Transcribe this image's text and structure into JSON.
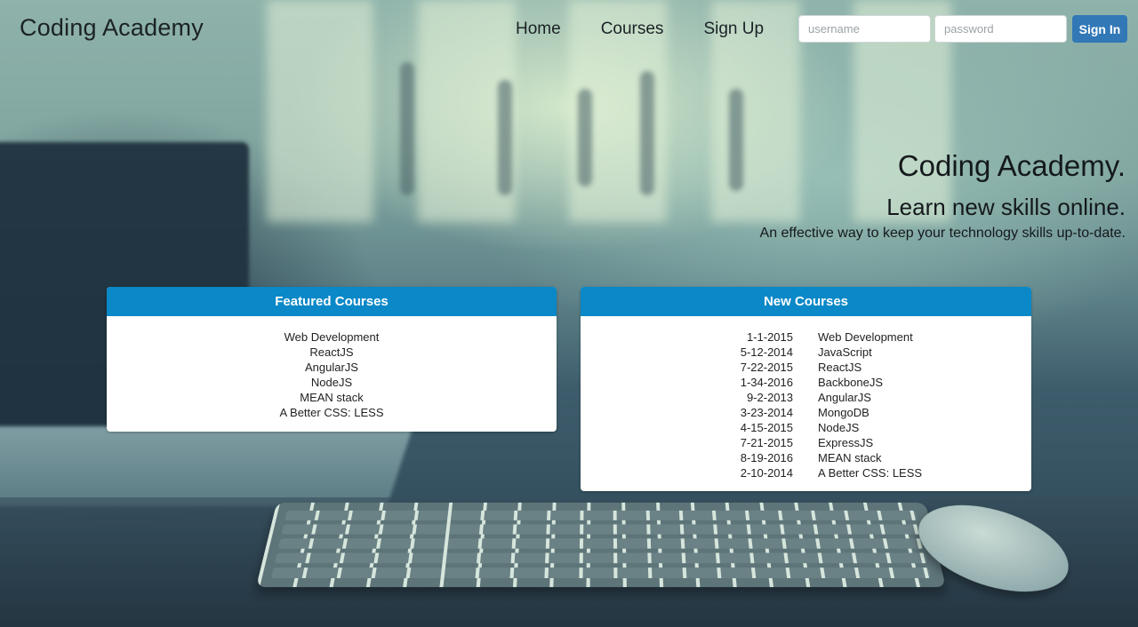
{
  "navbar": {
    "brand": "Coding Academy",
    "links": [
      "Home",
      "Courses",
      "Sign Up"
    ],
    "username_placeholder": "username",
    "password_placeholder": "password",
    "signin_label": "Sign In",
    "signin_color": "#3278b7"
  },
  "hero": {
    "title": "Coding Academy.",
    "subtitle": "Learn new skills online.",
    "description": "An effective way to keep your technology skills up-to-date."
  },
  "featured": {
    "title": "Featured Courses",
    "items": [
      "Web Development",
      "ReactJS",
      "AngularJS",
      "NodeJS",
      "MEAN stack",
      "A Better CSS: LESS"
    ]
  },
  "new_courses": {
    "title": "New Courses",
    "rows": [
      {
        "date": "1-1-2015",
        "name": "Web Development"
      },
      {
        "date": "5-12-2014",
        "name": "JavaScript"
      },
      {
        "date": "7-22-2015",
        "name": "ReactJS"
      },
      {
        "date": "1-34-2016",
        "name": "BackboneJS"
      },
      {
        "date": "9-2-2013",
        "name": "AngularJS"
      },
      {
        "date": "3-23-2014",
        "name": "MongoDB"
      },
      {
        "date": "4-15-2015",
        "name": "NodeJS"
      },
      {
        "date": "7-21-2015",
        "name": "ExpressJS"
      },
      {
        "date": "8-19-2016",
        "name": "MEAN stack"
      },
      {
        "date": "2-10-2014",
        "name": "A Better CSS: LESS"
      }
    ]
  },
  "colors": {
    "panel_header": "#0a88c7",
    "text": "#1b2226"
  }
}
